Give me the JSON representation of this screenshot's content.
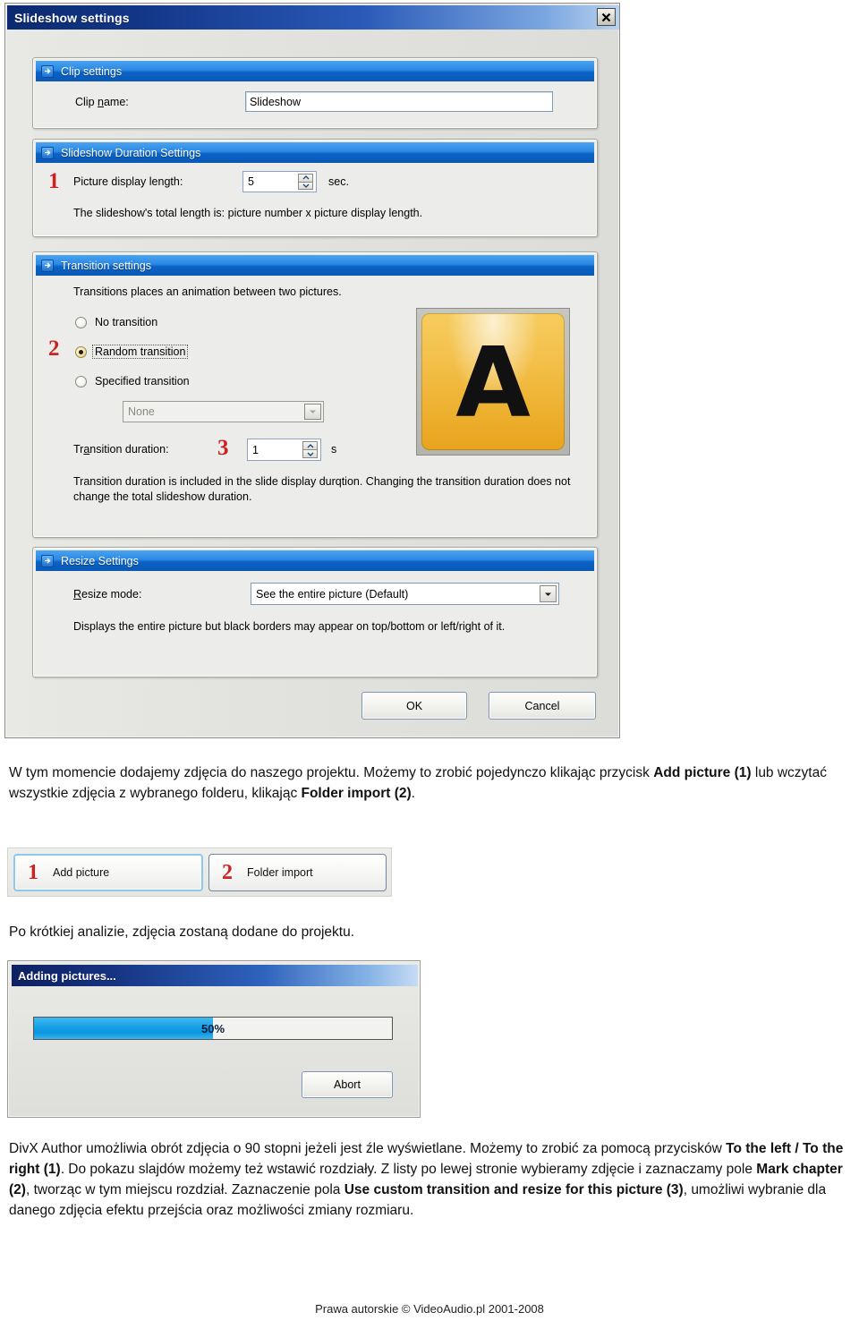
{
  "dialog": {
    "title": "Slideshow settings",
    "close_icon": "close-icon",
    "groups": {
      "clip": {
        "header": "Clip settings",
        "clip_name_label": "Clip name:",
        "clip_name_value": "Slideshow"
      },
      "duration": {
        "header": "Slideshow Duration Settings",
        "marker": "1",
        "picture_display_length_label": "Picture display length:",
        "picture_display_length_value": "5",
        "unit": "sec.",
        "note": "The slideshow's total length is: picture number x picture display length."
      },
      "transition": {
        "header": "Transition settings",
        "intro": "Transitions places an animation between two pictures.",
        "marker_radio": "2",
        "marker_duration": "3",
        "options": [
          {
            "label": "No transition",
            "checked": false
          },
          {
            "label": "Random transition",
            "checked": true
          },
          {
            "label": "Specified transition",
            "checked": false
          }
        ],
        "transition_select_value": "None",
        "duration_label": "Transition duration:",
        "duration_value": "1",
        "duration_unit": "s",
        "note": "Transition duration is included in the slide display durqtion. Changing the transition duration does not change the total slideshow duration.",
        "preview_letter": "A"
      },
      "resize": {
        "header": "Resize Settings",
        "mode_label": "Resize mode:",
        "mode_value": "See the entire picture (Default)",
        "note": "Displays the entire picture but black borders may appear on top/bottom or left/right of it."
      }
    },
    "buttons": {
      "ok": "OK",
      "cancel": "Cancel"
    }
  },
  "paragraph1": {
    "part1": "W tym momencie dodajemy zdjęcia do naszego projektu. Możemy to zrobić pojedynczo klikając przycisk ",
    "bold1": "Add picture (1)",
    "part2": " lub wczytać wszystkie zdjęcia z wybranego folderu, klikając ",
    "bold2": "Folder import (2)",
    "part3": "."
  },
  "toolbar": {
    "buttons": [
      {
        "number": "1",
        "label": "Add picture"
      },
      {
        "number": "2",
        "label": "Folder import"
      }
    ]
  },
  "paragraph2": {
    "text": "Po krótkiej analizie, zdjęcia zostaną dodane do projektu."
  },
  "progress_dialog": {
    "title": "Adding pictures...",
    "percent": "50%",
    "percent_value": 50,
    "abort_label": "Abort"
  },
  "paragraph3": {
    "part1": "DivX Author umożliwia obrót zdjęcia o 90 stopni jeżeli jest źle wyświetlane. Możemy to zrobić za pomocą przycisków ",
    "bold1": "To the left / To the right (1)",
    "part2": ". Do pokazu slajdów możemy też wstawić rozdziały. Z listy po lewej stronie wybieramy zdjęcie i zaznaczamy pole ",
    "bold2": "Mark chapter (2)",
    "part3": ", tworząc w tym miejscu rozdział. Zaznaczenie pola ",
    "bold3": "Use custom transition and resize for this picture (3)",
    "part4": ", umożliwi wybranie dla danego zdjęcia efektu przejścia oraz możliwości zmiany rozmiaru."
  },
  "footer": {
    "text": "Prawa autorskie © VideoAudio.pl 2001-2008"
  },
  "colors": {
    "titlebar_dark": "#0b2a70",
    "group_header_blue": "#0b63c6",
    "marker_red": "#cc2222",
    "progress_fill": "#16a0e8",
    "preview_amber": "#f3c04a"
  }
}
